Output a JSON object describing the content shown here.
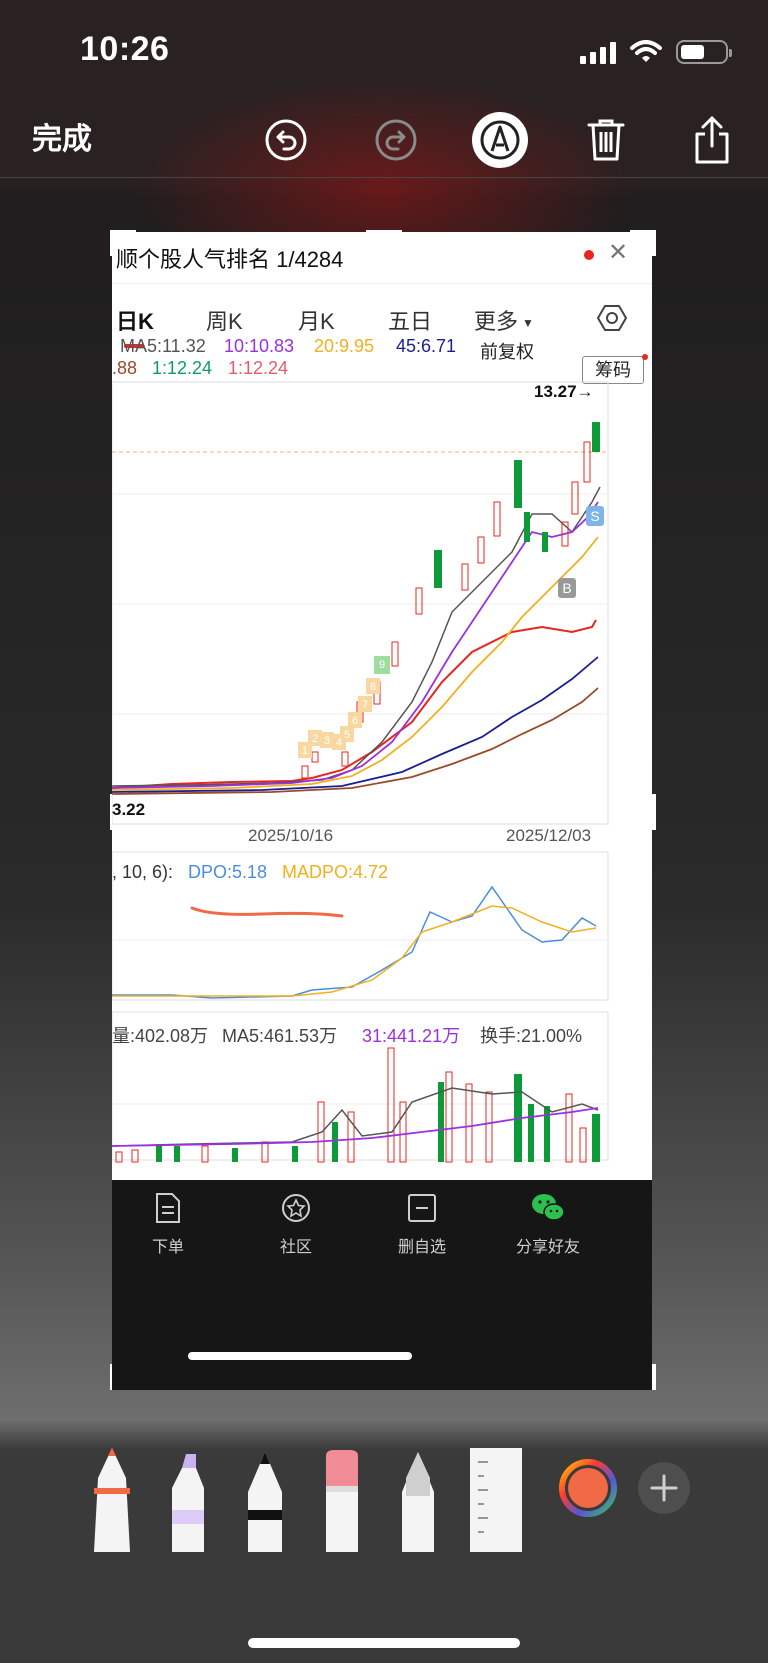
{
  "status": {
    "time": "10:26"
  },
  "toolbar": {
    "done_label": "完成"
  },
  "stock": {
    "header_title": "顺个股人气排名 1/4284",
    "tabs": [
      "日K",
      "周K",
      "月K",
      "五日",
      "更多"
    ],
    "ma_row1": {
      "ma5": "MA5:11.32",
      "ma10": "10:10.83",
      "ma20": "20:9.95",
      "ma45": "45:6.71"
    },
    "ma_row2": {
      "a": ".88",
      "b": "1:12.24",
      "c": "1:12.24"
    },
    "fuquan_label": "前复权",
    "chouma_label": "筹码",
    "high_label": "13.27→",
    "low_label": "3.22",
    "date_left": "2025/10/16",
    "date_right": "2025/12/03",
    "signal_buy": "B",
    "signal_sell": "S",
    "dpo_params": ", 10, 6):",
    "dpo_value": "DPO:5.18",
    "madpo_value": "MADPO:4.72",
    "vol_label": "量:402.08万",
    "vol_ma5": "MA5:461.53万",
    "vol_ma31": "31:441.21万",
    "turnover": "换手:21.00%",
    "nav": [
      "下单",
      "社区",
      "删自选",
      "分享好友"
    ],
    "td_numbers": [
      "1",
      "2",
      "3",
      "4",
      "5",
      "6",
      "7",
      "8",
      "9"
    ]
  },
  "colors": {
    "up_red": "#e8251f",
    "down_green": "#0d9b3a",
    "ma5": "#555555",
    "ma10": "#9b30e0",
    "ma20": "#f2b01e",
    "ma45": "#1b1f8f",
    "ma60": "#9a4a2a",
    "dpo": "#4a8de0",
    "madpo": "#f2b01e"
  },
  "icons": [
    "undo-icon",
    "redo-icon",
    "markup-pen-icon",
    "trash-icon",
    "share-icon",
    "color-picker-icon",
    "add-icon"
  ]
}
